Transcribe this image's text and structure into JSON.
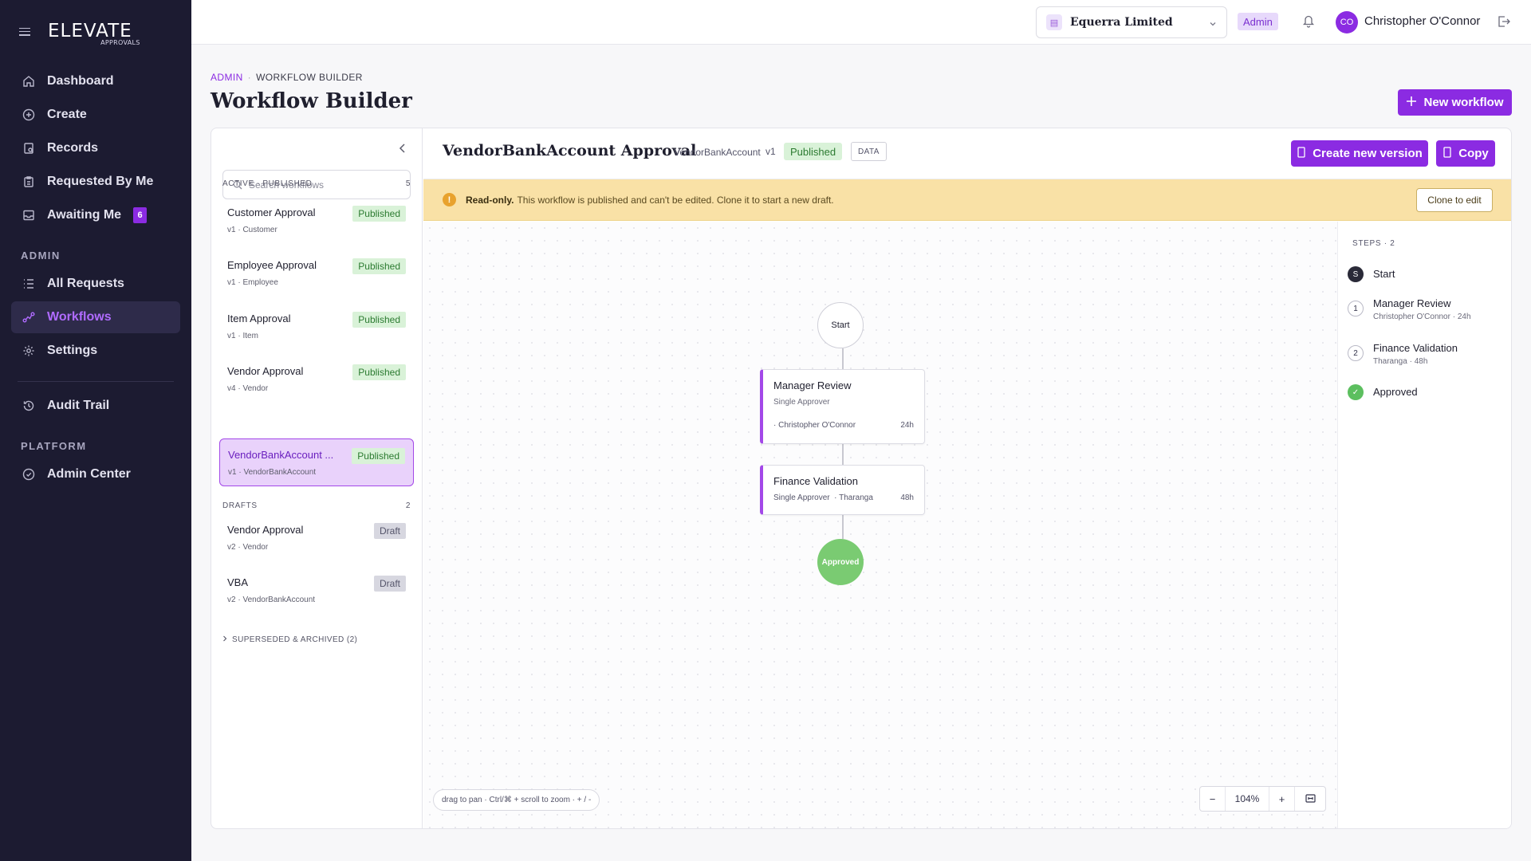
{
  "brand": {
    "logo": "ELEVATE",
    "logo_sub": "APPROVALS"
  },
  "sidebar": {
    "main": [
      {
        "label": "Dashboard",
        "icon": "home-icon"
      },
      {
        "label": "Create",
        "icon": "plus-circle-icon"
      },
      {
        "label": "Records",
        "icon": "records-icon"
      },
      {
        "label": "Requested By Me",
        "icon": "clipboard-icon"
      },
      {
        "label": "Awaiting Me",
        "icon": "inbox-icon",
        "badge": "6"
      }
    ],
    "admin_heading": "ADMIN",
    "admin": [
      {
        "label": "All Requests",
        "icon": "list-icon"
      },
      {
        "label": "Workflows",
        "icon": "workflow-icon",
        "active": true
      },
      {
        "label": "Settings",
        "icon": "gear-icon"
      }
    ],
    "other": [
      {
        "label": "Audit Trail",
        "icon": "history-icon"
      }
    ],
    "platform_heading": "PLATFORM",
    "platform": [
      {
        "label": "Admin Center",
        "icon": "admin-center-icon"
      }
    ]
  },
  "topbar": {
    "org_name": "Equerra Limited",
    "role": "Admin",
    "user_initials": "CO",
    "user_name": "Christopher O'Connor"
  },
  "page": {
    "crumb_root": "ADMIN",
    "crumb_current": "WORKFLOW BUILDER",
    "title": "Workflow Builder",
    "new_workflow": "New workflow"
  },
  "list": {
    "search_placeholder": "Search workflows",
    "active_heading": "ACTIVE · PUBLISHED",
    "active_count": "5",
    "active": [
      {
        "name": "Customer Approval",
        "meta": "v1 · Customer",
        "status": "Published"
      },
      {
        "name": "Employee Approval",
        "meta": "v1 · Employee",
        "status": "Published"
      },
      {
        "name": "Item Approval",
        "meta": "v1 · Item",
        "status": "Published"
      },
      {
        "name": "Vendor Approval",
        "meta": "v4 · Vendor",
        "status": "Published"
      },
      {
        "name": "VendorBankAccount ...",
        "meta": "v1 · VendorBankAccount",
        "status": "Published"
      }
    ],
    "drafts_heading": "DRAFTS",
    "drafts_count": "2",
    "drafts": [
      {
        "name": "Vendor Approval",
        "meta": "v2 · Vendor",
        "status": "Draft"
      },
      {
        "name": "VBA",
        "meta": "v2 · VendorBankAccount",
        "status": "Draft"
      }
    ],
    "superseded": "SUPERSEDED & ARCHIVED (2)"
  },
  "detail": {
    "title": "VendorBankAccount Approval",
    "entity": "VendorBankAccount",
    "version": "v1",
    "status": "Published",
    "data_tag": "DATA",
    "create_version": "Create new version",
    "copy": "Copy",
    "readonly_bold": "Read-only.",
    "readonly_text": "This workflow is published and can't be edited. Clone it to start a new draft.",
    "clone": "Clone to edit"
  },
  "canvas": {
    "start": "Start",
    "approved": "Approved",
    "nodes": [
      {
        "title": "Manager Review",
        "type": "Single Approver",
        "assignee": "· Christopher O'Connor",
        "sla": "24h"
      },
      {
        "title": "Finance Validation",
        "type": "Single Approver",
        "assignee": "· Tharanga",
        "sla": "48h"
      }
    ],
    "hint": "drag to pan · Ctrl/⌘ + scroll to zoom · + / -",
    "zoom_out": "−",
    "zoom_level": "104%",
    "zoom_in": "+"
  },
  "steps": {
    "heading": "STEPS · 2",
    "items": [
      {
        "marker": "S",
        "label": "Start",
        "sub": ""
      },
      {
        "marker": "1",
        "label": "Manager Review",
        "sub": "Christopher O'Connor · 24h"
      },
      {
        "marker": "2",
        "label": "Finance Validation",
        "sub": "Tharanga · 48h"
      },
      {
        "marker": "✓",
        "label": "Approved",
        "sub": ""
      }
    ]
  },
  "colors": {
    "accent": "#8b2be2",
    "sidebar_bg": "#1c1b31",
    "published_bg": "#d9f2d8",
    "approved": "#7acb72",
    "warning_bg": "#f9e1a6"
  }
}
